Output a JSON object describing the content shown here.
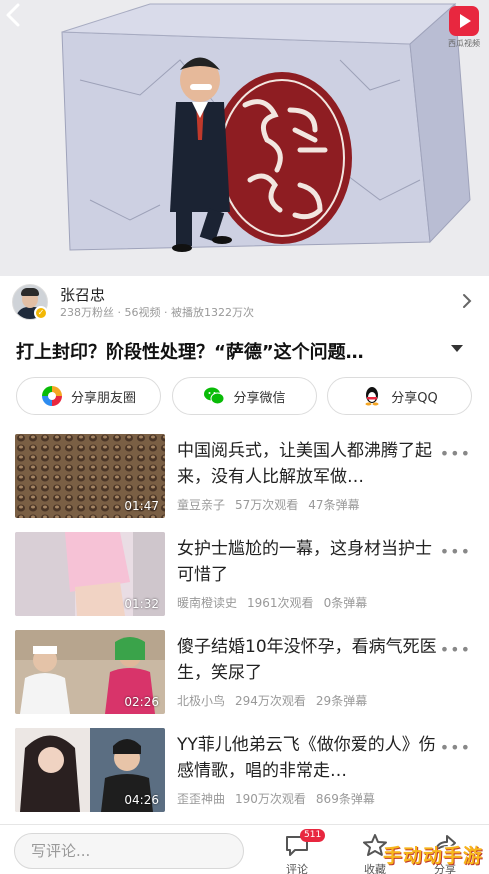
{
  "brand": {
    "logo_text": "西瓜视频"
  },
  "author": {
    "name": "张召忠",
    "meta": "238万粉丝 · 56视频 · 被播放1322万次"
  },
  "video": {
    "title": "打上封印？阶段性处理？“萨德”这个问题…"
  },
  "share": {
    "moments": "分享朋友圈",
    "wechat": "分享微信",
    "qq": "分享QQ"
  },
  "related": [
    {
      "title": "中国阅兵式，让美国人都沸腾了起来，没有人比解放军做…",
      "duration": "01:47",
      "author": "童豆亲子",
      "views": "57万次观看",
      "danmaku": "47条弹幕"
    },
    {
      "title": "女护士尴尬的一幕，这身材当护士可惜了",
      "duration": "01:32",
      "author": "暖南橙读史",
      "views": "1961次观看",
      "danmaku": "0条弹幕"
    },
    {
      "title": "傻子结婚10年没怀孕，看病气死医生，笑尿了",
      "duration": "02:26",
      "author": "北极小鸟",
      "views": "294万次观看",
      "danmaku": "29条弹幕"
    },
    {
      "title": "YY菲儿他弟云飞《做你爱的人》伤感情歌，唱的非常走…",
      "duration": "04:26",
      "author": "歪歪神曲",
      "views": "190万次观看",
      "danmaku": "869条弹幕"
    }
  ],
  "bottom": {
    "comment_placeholder": "写评论...",
    "comment_label": "评论",
    "comment_count": "511",
    "fav_label": "收藏",
    "share_label": "分享"
  },
  "watermark": "手动动手游",
  "colors": {
    "accent": "#e8273f",
    "wechat": "#09bb07",
    "muted": "#999999"
  }
}
